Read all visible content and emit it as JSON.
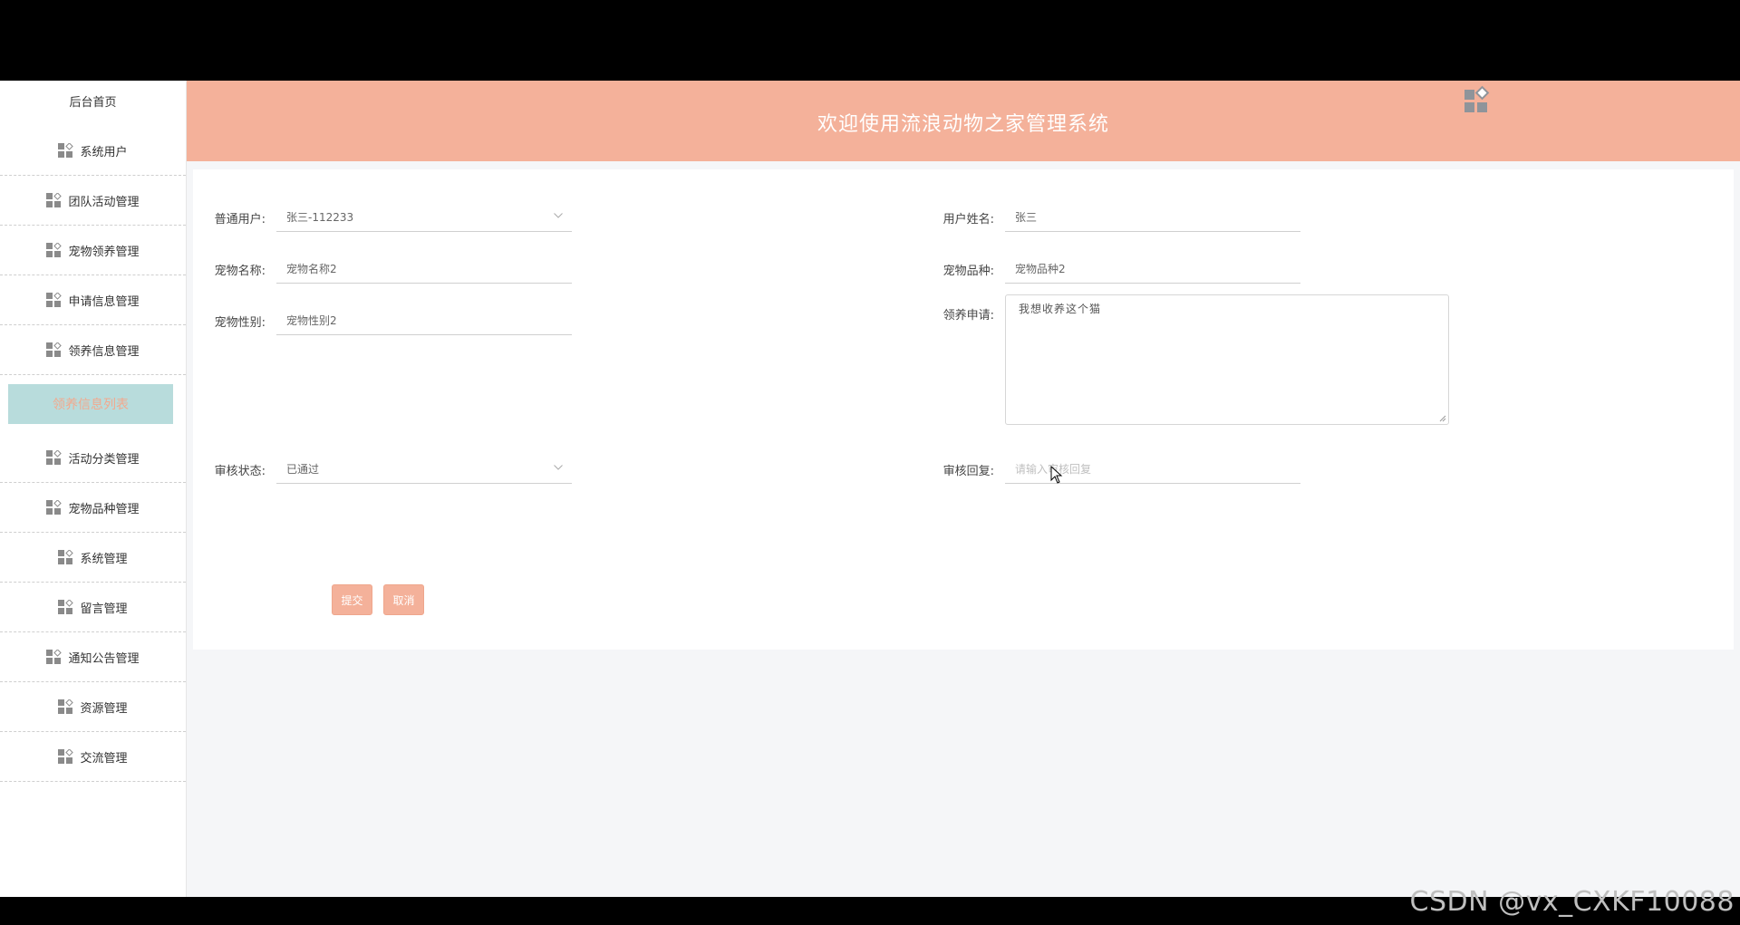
{
  "sidebar": {
    "home": "后台首页",
    "items": [
      {
        "label": "系统用户",
        "icon": "grid-app-icon"
      },
      {
        "label": "团队活动管理",
        "icon": "grid-app-icon"
      },
      {
        "label": "宠物领养管理",
        "icon": "grid-app-icon"
      },
      {
        "label": "申请信息管理",
        "icon": "grid-app-icon"
      },
      {
        "label": "领养信息管理",
        "icon": "grid-app-icon"
      }
    ],
    "active_sub": "领养信息列表",
    "items_after": [
      {
        "label": "活动分类管理",
        "icon": "grid-app-icon"
      },
      {
        "label": "宠物品种管理",
        "icon": "grid-app-icon"
      },
      {
        "label": "系统管理",
        "icon": "grid-app-icon"
      },
      {
        "label": "留言管理",
        "icon": "grid-app-icon"
      },
      {
        "label": "通知公告管理",
        "icon": "grid-app-icon"
      },
      {
        "label": "资源管理",
        "icon": "grid-app-icon"
      },
      {
        "label": "交流管理",
        "icon": "grid-app-icon"
      }
    ]
  },
  "header": {
    "title": "欢迎使用流浪动物之家管理系统",
    "user_icon": "grid-app-icon",
    "bg_color": "#f4b19a"
  },
  "form": {
    "user": {
      "label": "普通用户:",
      "value": "张三-112233"
    },
    "user_name": {
      "label": "用户姓名:",
      "value": "张三"
    },
    "pet_name": {
      "label": "宠物名称:",
      "value": "宠物名称2"
    },
    "pet_breed": {
      "label": "宠物品种:",
      "value": "宠物品种2"
    },
    "pet_gender": {
      "label": "宠物性别:",
      "value": "宠物性别2"
    },
    "application": {
      "label": "领养申请:",
      "value": "我想收养这个猫"
    },
    "review_status": {
      "label": "审核状态:",
      "value": "已通过"
    },
    "review_reply": {
      "label": "审核回复:",
      "placeholder": "请输入审核回复"
    },
    "submit": "提交",
    "cancel": "取消"
  },
  "watermark": "CSDN @vx_CXKF10088"
}
